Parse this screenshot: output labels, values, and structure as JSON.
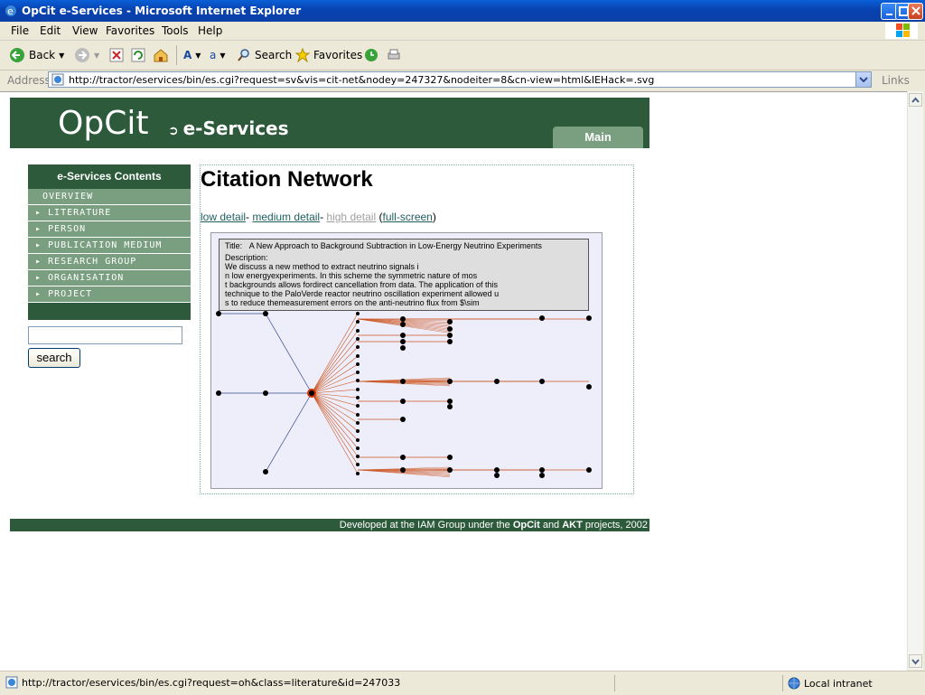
{
  "window": {
    "title": "OpCit e-Services - Microsoft Internet Explorer"
  },
  "menu": [
    "File",
    "Edit",
    "View",
    "Favorites",
    "Tools",
    "Help"
  ],
  "toolbar": {
    "back": "Back",
    "search": "Search",
    "favorites": "Favorites"
  },
  "address": {
    "label": "Address",
    "url": "http://tractor/eservices/bin/es.cgi?request=sv&vis=cit-net&nodey=247327&nodeiter=8&cn-view=html&IEHack=.svg",
    "links": "Links"
  },
  "page": {
    "logo": "OpCit",
    "logo_sub": "e-Services",
    "tab": "Main",
    "sidebar": {
      "title": "e-Services Contents",
      "items": [
        "OVERVIEW",
        "▸ LITERATURE",
        "▸ PERSON",
        "▸ PUBLICATION MEDIUM",
        "▸ RESEARCH GROUP",
        "▸ ORGANISATION",
        "▸ PROJECT"
      ]
    },
    "search_button": "search",
    "content_title": "Citation Network",
    "links": {
      "low": "low detail",
      "medium": "medium detail",
      "high": "high detail",
      "full": "full-screen",
      "sep": "-",
      "open": "(",
      "close": ")"
    },
    "info": {
      "title_label": "Title:",
      "title": "A New Approach to Background Subtraction in Low-Energy Neutrino Experiments",
      "desc_label": "Description:",
      "desc_lines": [
        "We discuss a new method to extract neutrino signals i",
        "n low energyexperiments. In this scheme the symmetric nature of mos",
        "t backgrounds allows fordirect cancellation from data. The application of this",
        "technique to the PaloVerde reactor neutrino oscillation experiment allowed u",
        "s to reduce themeasurement errors on the anti-neutrino flux from $\\sim"
      ]
    },
    "footer": {
      "pre": "Developed at the IAM Group under the ",
      "b1": "OpCit",
      "mid": " and ",
      "b2": "AKT",
      "post": " projects, 2002"
    }
  },
  "status": {
    "text": "http://tractor/eservices/bin/es.cgi?request=oh&class=literature&id=247033",
    "zone": "Local intranet"
  },
  "colors": {
    "green": "#2d5a3a",
    "sidebar": "#7a9e80",
    "edge": "#cc5522"
  }
}
